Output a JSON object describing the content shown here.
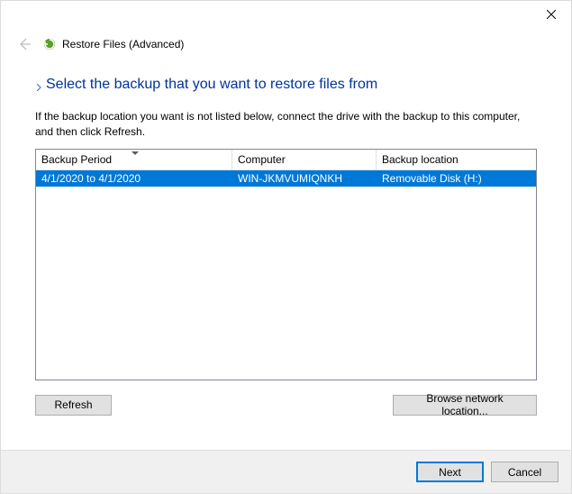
{
  "window": {
    "title": "Restore Files (Advanced)"
  },
  "page": {
    "heading": "Select the backup that you want to restore files from",
    "instruction": "If the backup location you want is not listed below, connect the drive with the backup to this computer, and then click Refresh."
  },
  "columns": {
    "period": "Backup Period",
    "computer": "Computer",
    "location": "Backup location"
  },
  "rows": [
    {
      "period": "4/1/2020 to 4/1/2020",
      "computer": "WIN-JKMVUMIQNKH",
      "location": "Removable Disk (H:)",
      "selected": true
    }
  ],
  "buttons": {
    "refresh": "Refresh",
    "browse": "Browse network location...",
    "next": "Next",
    "cancel": "Cancel"
  }
}
